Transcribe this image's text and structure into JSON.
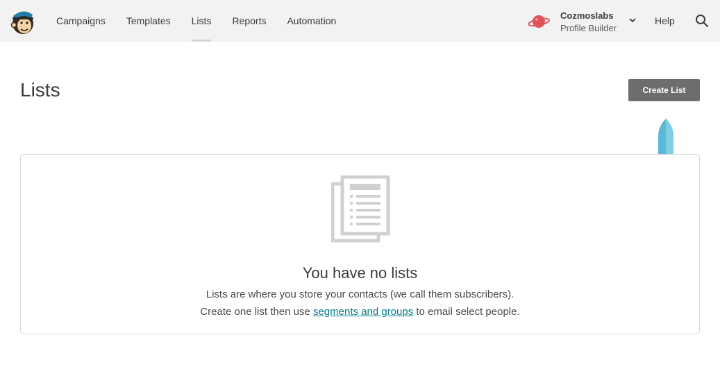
{
  "header": {
    "logo_icon": "freddie-monkey-logo-icon",
    "nav": [
      {
        "label": "Campaigns",
        "active": false
      },
      {
        "label": "Templates",
        "active": false
      },
      {
        "label": "Lists",
        "active": true
      },
      {
        "label": "Reports",
        "active": false
      },
      {
        "label": "Automation",
        "active": false
      }
    ],
    "account": {
      "name": "Cozmoslabs",
      "subtitle": "Profile Builder",
      "avatar_icon": "planet-icon",
      "dropdown_icon": "chevron-down-icon"
    },
    "help_label": "Help",
    "search_icon": "search-icon"
  },
  "page": {
    "title": "Lists",
    "create_button_label": "Create List",
    "pointer_icon": "pointer-marker-icon"
  },
  "empty_state": {
    "icon": "document-list-icon",
    "title": "You have no lists",
    "line1": "Lists are where you store your contacts (we call them subscribers).",
    "line2_before": "Create one list then use ",
    "line2_link": "segments and groups",
    "line2_after": " to email select people."
  },
  "colors": {
    "topbar_bg": "#f2f2f2",
    "button_bg": "#6d6d6d",
    "link": "#007c89",
    "pointer": "#5ab9d8",
    "planet": "#e0535d"
  }
}
